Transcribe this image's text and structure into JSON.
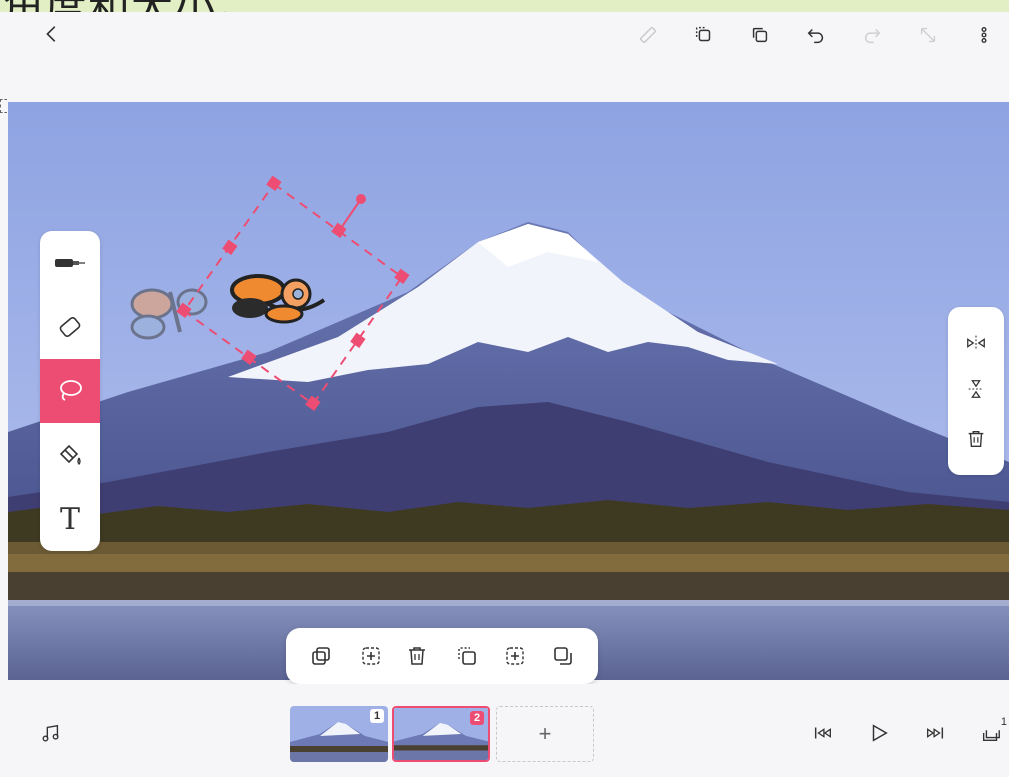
{
  "banner": {
    "caption": "角度和大小。"
  },
  "toolbar": {
    "back": "back-icon",
    "items": [
      "ruler-icon",
      "copy-frame-icon",
      "duplicate-icon",
      "undo-icon",
      "redo-icon",
      "expand-icon",
      "more-icon"
    ]
  },
  "tools": {
    "items": [
      "pen-icon",
      "eraser-icon",
      "lasso-icon",
      "fill-bucket-icon",
      "text-icon"
    ],
    "active": "lasso-icon",
    "text_glyph": "T"
  },
  "right_panel": {
    "items": [
      "flip-horizontal-icon",
      "flip-vertical-icon",
      "delete-icon"
    ]
  },
  "selection_popup": {
    "items": [
      "copy-icon",
      "add-to-selection-icon",
      "delete-icon",
      "paste-icon",
      "add-icon",
      "clone-icon"
    ]
  },
  "timeline": {
    "frames": [
      {
        "number": "1",
        "selected": false
      },
      {
        "number": "2",
        "selected": true
      }
    ],
    "add_label": "+",
    "music_icon": "music-note-icon",
    "playback": [
      "jump-start-icon",
      "play-icon",
      "jump-end-icon",
      "layers-icon"
    ],
    "layers_count": "1"
  },
  "colors": {
    "accent": "#ee4d73",
    "banner": "#e2efc4"
  }
}
